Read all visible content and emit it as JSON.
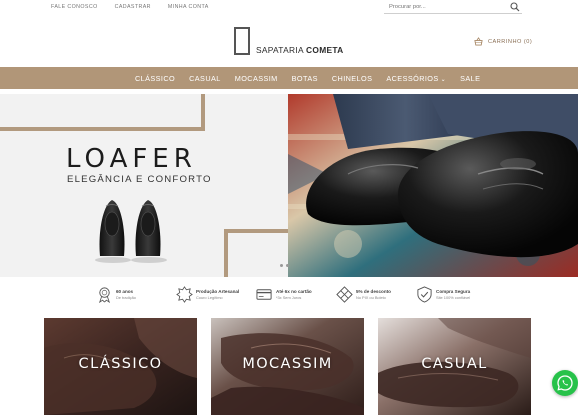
{
  "topbar": {
    "links": [
      "FALE CONOSCO",
      "CADASTRAR",
      "MINHA CONTA"
    ],
    "search_placeholder": "Procurar por..."
  },
  "header": {
    "logo_light": "SAPATARIA",
    "logo_bold": "COMETA",
    "cart_label": "CARRINHO (0)"
  },
  "nav": {
    "items": [
      "CLÁSSICO",
      "CASUAL",
      "MOCASSIM",
      "BOTAS",
      "CHINELOS",
      "ACESSÓRIOS",
      "SALE"
    ]
  },
  "hero": {
    "title": "LOAFER",
    "subtitle": "ELEGÂNCIA E CONFORTO"
  },
  "features": [
    {
      "title": "60 anos",
      "subtitle": "De tradição",
      "icon": "award-medal-icon"
    },
    {
      "title": "Produção Artesanal",
      "subtitle": "Couro Legítimo",
      "icon": "leather-hide-icon"
    },
    {
      "title": "Até 6x no cartão",
      "subtitle": "*3x Sem Juros",
      "icon": "credit-card-icon"
    },
    {
      "title": "5% de desconto",
      "subtitle": "No PIX ou Boleto",
      "icon": "pix-icon"
    },
    {
      "title": "Compra Segura",
      "subtitle": "Site 100% confiável",
      "icon": "shield-check-icon"
    }
  ],
  "categories": [
    "CLÁSSICO",
    "MOCASSIM",
    "CASUAL"
  ],
  "colors": {
    "nav_bg": "#b19678",
    "accent_frame": "#b29a7f",
    "whatsapp": "#27c24a"
  }
}
